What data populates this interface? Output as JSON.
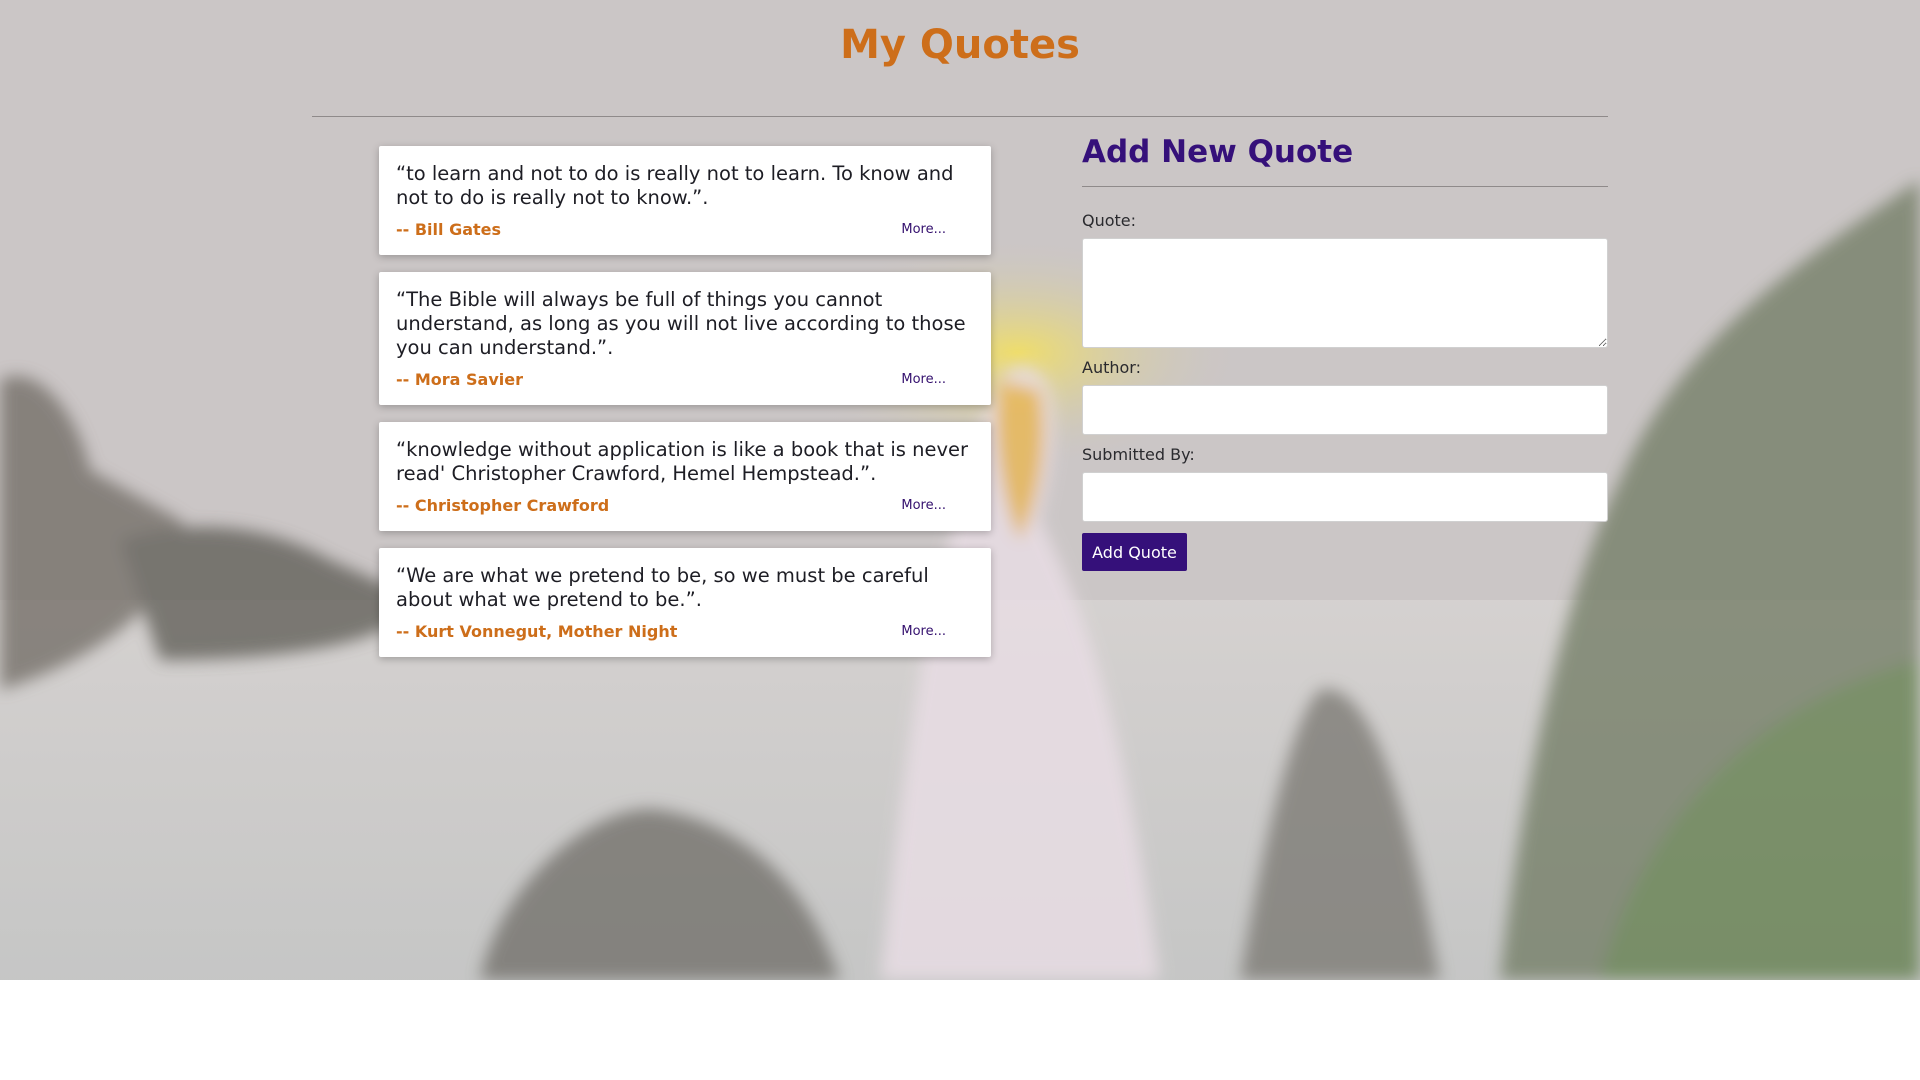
{
  "header": {
    "title": "My Quotes"
  },
  "quotes": [
    {
      "text": "“to learn and not to do is really not to learn. To know and not to do is really not to know.”.",
      "author": "-- Bill Gates",
      "more_label": "More..."
    },
    {
      "text": "“The Bible will always be full of things you cannot understand, as long as you will not live according to those you can understand.”.",
      "author": "-- Mora Savier",
      "more_label": "More..."
    },
    {
      "text": "“knowledge without application is like a book that is never read' Christopher Crawford, Hemel Hempstead.”.",
      "author": "-- Christopher Crawford",
      "more_label": "More..."
    },
    {
      "text": "“We are what we pretend to be, so we must be careful about what we pretend to be.”.",
      "author": "-- Kurt Vonnegut, Mother Night",
      "more_label": "More..."
    }
  ],
  "form": {
    "title": "Add New Quote",
    "quote_label": "Quote:",
    "quote_value": "",
    "author_label": "Author:",
    "author_value": "",
    "submitted_by_label": "Submitted By:",
    "submitted_by_value": "",
    "submit_label": "Add Quote"
  },
  "colors": {
    "accent_orange": "#cd6e1a",
    "accent_purple": "#35107a",
    "hero_background": "#cbc6c6"
  }
}
